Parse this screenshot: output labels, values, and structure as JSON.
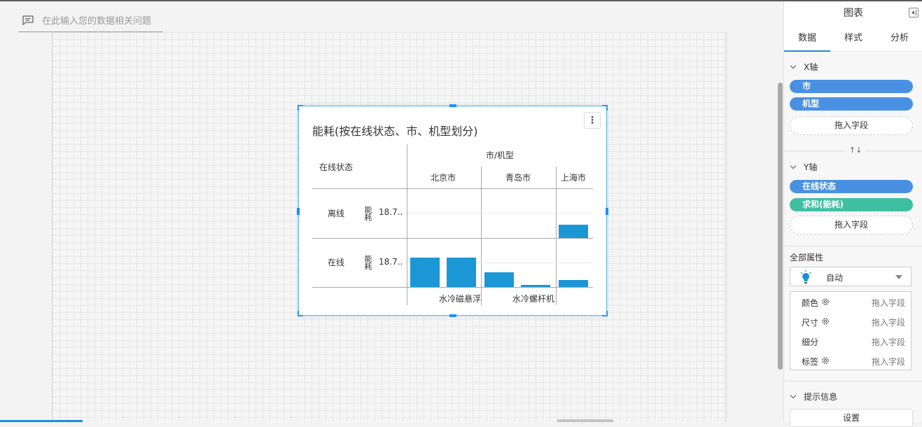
{
  "question": {
    "placeholder": "在此输入您的数据相关问题",
    "icon": "comment-icon"
  },
  "widget": {
    "title": "能耗(按在线状态、市、机型划分)",
    "menu_icon": "more-vertical-icon",
    "row_header": "在线状态",
    "col_header": "市/机型",
    "cities": [
      "北京市",
      "青岛市",
      "上海市"
    ],
    "rows": [
      {
        "status": "离线",
        "measure": "能耗",
        "axis_value": "18.7.."
      },
      {
        "status": "在线",
        "measure": "能耗",
        "axis_value": "18.7.."
      }
    ],
    "machine_types": [
      "水冷磁悬浮",
      "水冷螺杆机"
    ],
    "bar_color": "#1c97d5",
    "bars": [
      {
        "city": "上海市",
        "status": "离线",
        "value": 0.5
      },
      {
        "city": "北京市",
        "machine": "水冷磁悬浮",
        "status": "在线",
        "value": 1.1
      },
      {
        "city": "北京市",
        "machine": "水冷螺杆机",
        "status": "在线",
        "value": 1.1
      },
      {
        "city": "青岛市",
        "machine": "水冷磁悬浮",
        "status": "在线",
        "value": 0.55
      },
      {
        "city": "青岛市",
        "machine": "水冷螺杆机",
        "status": "在线",
        "value": 0.07
      },
      {
        "city": "上海市",
        "status": "在线",
        "value": 0.25
      }
    ]
  },
  "panel": {
    "title": "图表",
    "collapse_icon": "collapse-panel-icon",
    "tabs": [
      "数据",
      "样式",
      "分析"
    ],
    "active_tab": "数据",
    "x_axis": {
      "label": "X轴",
      "fields": [
        "市",
        "机型"
      ],
      "drop_label": "拖入字段"
    },
    "swap_icon": "↑↓",
    "y_axis": {
      "label": "Y轴",
      "fields": [
        "在线状态",
        "求和(能耗)"
      ],
      "drop_label": "拖入字段"
    },
    "all_props": {
      "label": "全部属性",
      "mark_type": "自动",
      "bulb_icon": "bulb-icon",
      "rows": [
        {
          "label": "颜色",
          "gear": true,
          "value": "拖入字段"
        },
        {
          "label": "尺寸",
          "gear": true,
          "value": "拖入字段"
        },
        {
          "label": "细分",
          "gear": false,
          "value": "拖入字段"
        },
        {
          "label": "标签",
          "gear": true,
          "value": "拖入字段"
        }
      ]
    },
    "tooltip": {
      "label": "提示信息",
      "button": "设置"
    }
  },
  "colors": {
    "accent": "#1890d6",
    "pill_blue": "#4a90e2",
    "pill_green": "#3fbfa2",
    "bar": "#1c97d5"
  }
}
